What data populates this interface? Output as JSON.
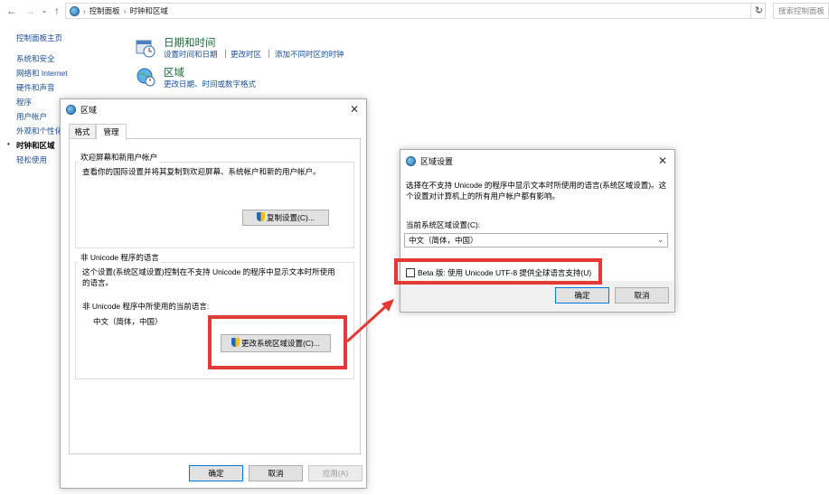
{
  "explorer": {
    "breadcrumb": [
      "控制面板",
      "时钟和区域"
    ],
    "search_placeholder": "搜索控制面板"
  },
  "sidebar": {
    "items": [
      {
        "label": "控制面板主页"
      },
      {
        "label": "系统和安全"
      },
      {
        "label": "网络和 Internet"
      },
      {
        "label": "硬件和声音"
      },
      {
        "label": "程序"
      },
      {
        "label": "用户帐户"
      },
      {
        "label": "外观和个性化"
      },
      {
        "label": "时钟和区域",
        "active": true
      },
      {
        "label": "轻松使用"
      }
    ]
  },
  "main": {
    "datetime": {
      "title": "日期和时间",
      "links": [
        "设置时间和日期",
        "更改时区",
        "添加不同时区的时钟"
      ]
    },
    "region": {
      "title": "区域",
      "link": "更改日期、时间或数字格式"
    }
  },
  "region_dialog": {
    "title": "区域",
    "tabs": [
      "格式",
      "管理"
    ],
    "welcome_group": {
      "title": "欢迎屏幕和新用户帐户",
      "desc": "查看你的国际设置并将其复制到欢迎屏幕、系统帐户和新的用户帐户。",
      "button": "复制设置(C)..."
    },
    "unicode_group": {
      "title": "非 Unicode 程序的语言",
      "desc": "这个设置(系统区域设置)控制在不支持 Unicode 的程序中显示文本时所使用的语言。",
      "current_label": "非 Unicode 程序中所使用的当前语言:",
      "current_value": "中文（简体，中国）",
      "button": "更改系统区域设置(C)..."
    },
    "ok": "确定",
    "cancel": "取消",
    "apply": "应用(A)"
  },
  "locale_dialog": {
    "title": "区域设置",
    "desc": "选择在不支持 Unicode 的程序中显示文本时所使用的语言(系统区域设置)。这个设置对计算机上的所有用户帐户都有影响。",
    "select_label": "当前系统区域设置(C):",
    "select_value": "中文（简体，中国）",
    "beta_checkbox": "Beta 版: 使用 Unicode UTF-8 提供全球语言支持(U)",
    "beta_checked": false,
    "ok": "确定",
    "cancel": "取消"
  },
  "colors": {
    "highlight": "#e53935",
    "link": "#1a4e9a",
    "category_title": "#1a6b39"
  }
}
